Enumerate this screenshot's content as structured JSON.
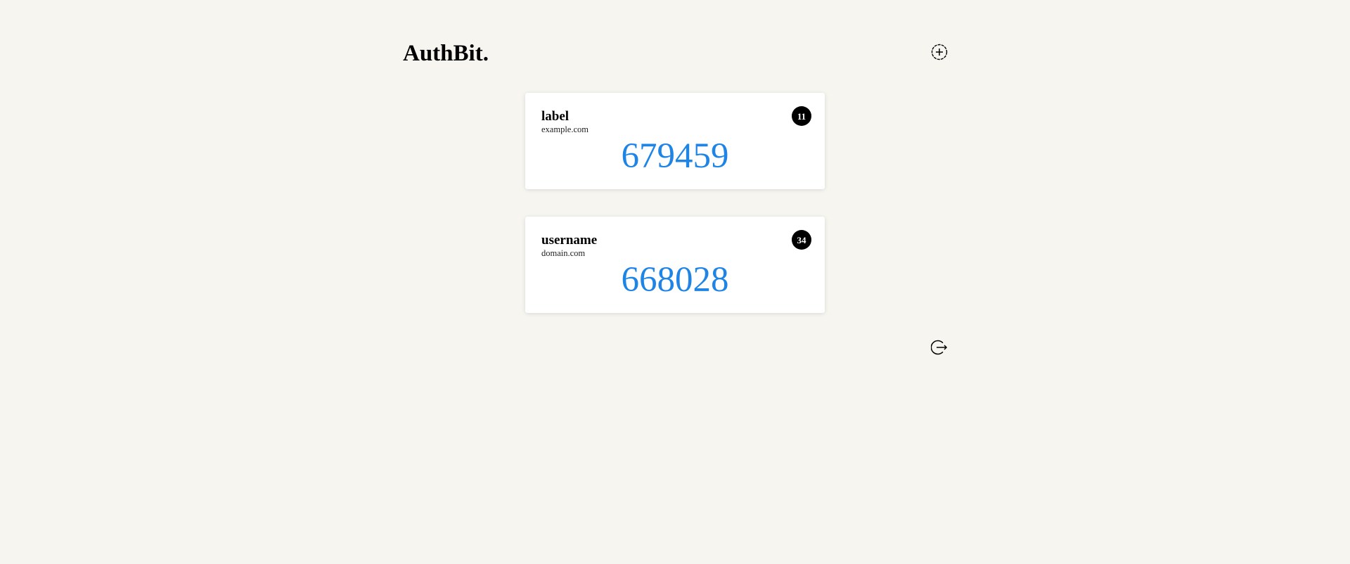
{
  "app": {
    "brand": "AuthBit."
  },
  "header": {
    "add_icon": "add-circle-icon"
  },
  "accounts": [
    {
      "label": "label",
      "domain": "example.com",
      "code": "679459",
      "seconds_remaining": "11"
    },
    {
      "label": "username",
      "domain": "domain.com",
      "code": "668028",
      "seconds_remaining": "34"
    }
  ],
  "footer": {
    "logout_icon": "logout-icon"
  },
  "colors": {
    "background": "#f6f5f0",
    "code": "#1e84e6",
    "badge": "#000000",
    "card": "#ffffff"
  }
}
